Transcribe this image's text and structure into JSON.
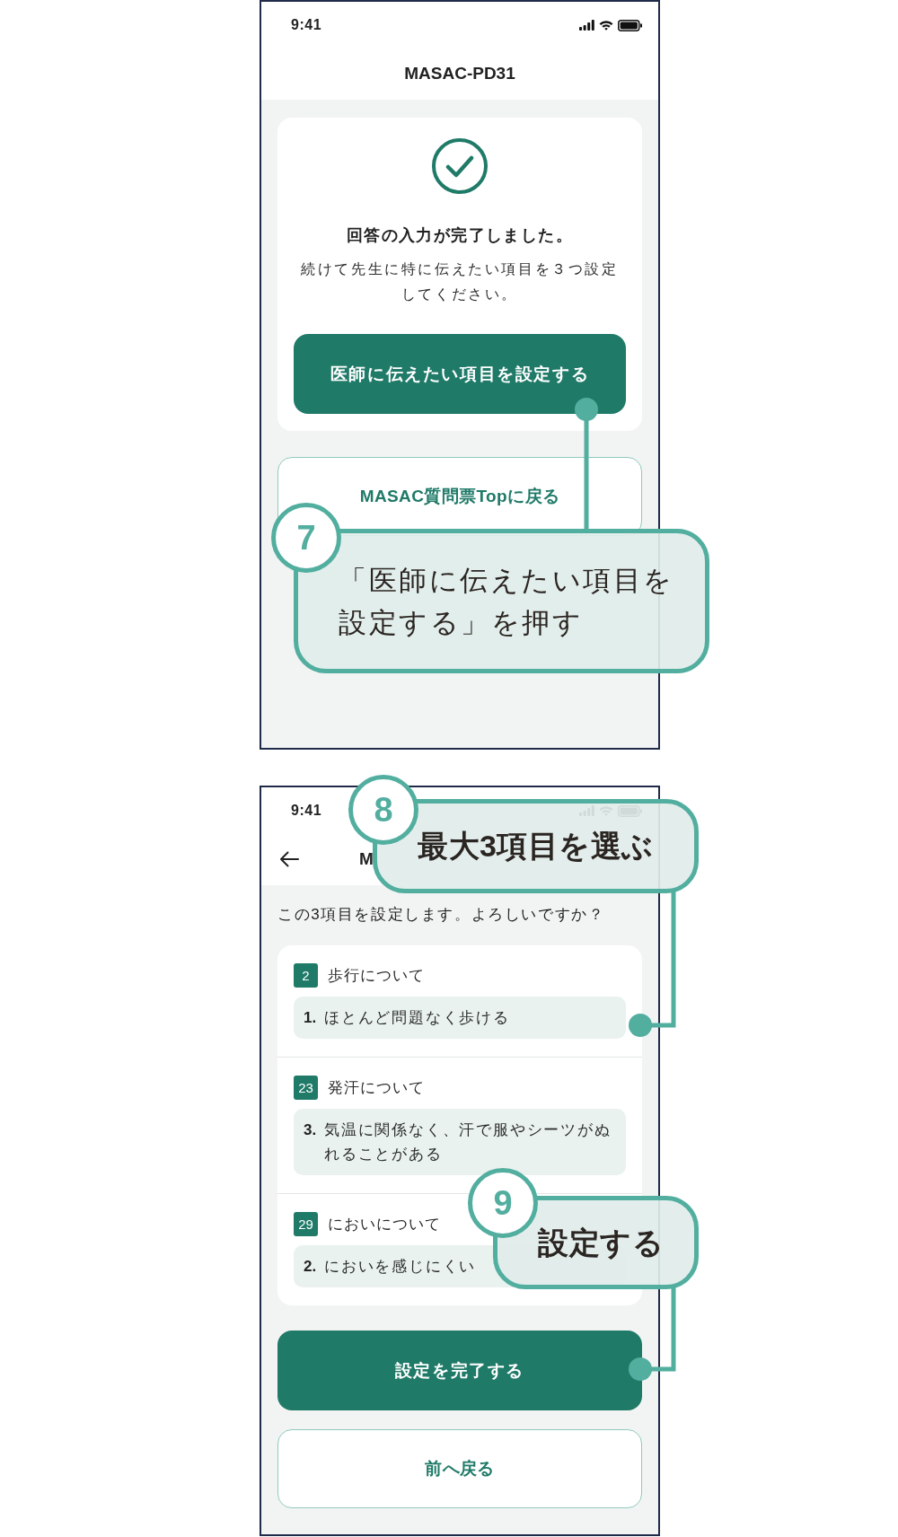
{
  "screens": [
    {
      "kind": "complete",
      "status_bar": {
        "time": "9:41"
      },
      "header": {
        "title": "MASAC-PD31"
      },
      "card": {
        "heading": "回答の入力が完了しました。",
        "message": "続けて先生に特に伝えたい項目を３つ設定してください。",
        "button": "医師に伝えたい項目を設定する"
      },
      "secondary_button": "MASAC質問票Topに戻る"
    },
    {
      "kind": "confirm",
      "status_bar": {
        "time": "9:41"
      },
      "header": {
        "title": "M"
      },
      "prompt": "この3項目を設定します。よろしいですか？",
      "items": [
        {
          "badge": "2",
          "title": "歩行について",
          "answer_number": "1.",
          "answer": "ほとんど問題なく歩ける"
        },
        {
          "badge": "23",
          "title": "発汗について",
          "answer_number": "3.",
          "answer": "気温に関係なく、汗で服やシーツがぬれることがある"
        },
        {
          "badge": "29",
          "title": "においについて",
          "answer_number": "2.",
          "answer": "においを感じにくい"
        }
      ],
      "primary_button": "設定を完了する",
      "secondary_button": "前へ戻る"
    }
  ],
  "callouts": [
    {
      "number": "7",
      "text": "「医師に伝えたい項目を設定する」を押す"
    },
    {
      "number": "8",
      "text": "最大3項目を選ぶ"
    },
    {
      "number": "9",
      "text": "設定する"
    }
  ]
}
